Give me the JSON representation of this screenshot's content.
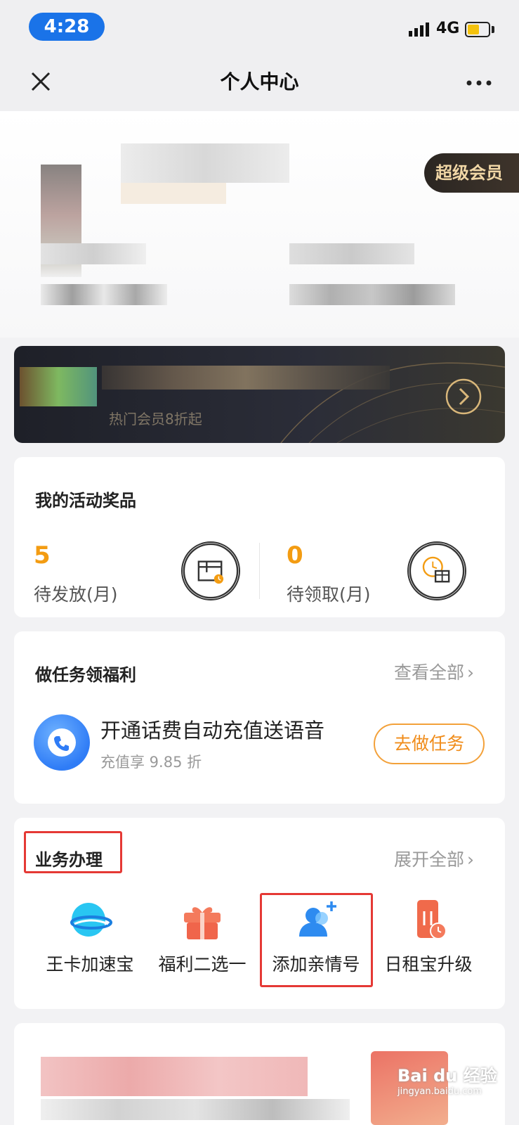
{
  "status_bar": {
    "time": "4:28",
    "network": "4G"
  },
  "nav": {
    "title": "个人中心"
  },
  "profile": {
    "member_badge": "超级会员"
  },
  "banner": {
    "subtitle": "热门会员8折起"
  },
  "prizes": {
    "title": "我的活动奖品",
    "pending_send": {
      "value": "5",
      "label": "待发放(月)"
    },
    "pending_claim": {
      "value": "0",
      "label": "待领取(月)"
    }
  },
  "tasks": {
    "title": "做任务领福利",
    "view_all": "查看全部",
    "item": {
      "title": "开通话费自动充值送语音",
      "subtitle": "充值享 9.85 折",
      "button": "去做任务"
    }
  },
  "services": {
    "title": "业务办理",
    "expand_all": "展开全部",
    "items": [
      {
        "label": "王卡加速宝",
        "icon": "speed-planet-icon"
      },
      {
        "label": "福利二选一",
        "icon": "gift-box-icon"
      },
      {
        "label": "添加亲情号",
        "icon": "add-contact-icon"
      },
      {
        "label": "日租宝升级",
        "icon": "phone-clock-icon"
      }
    ]
  },
  "watermark": {
    "brand": "Bai du 经验",
    "url": "jingyan.baidu.com"
  },
  "colors": {
    "accent_orange": "#f39c12",
    "highlight_red": "#e53935",
    "time_pill_blue": "#1a73e8"
  }
}
